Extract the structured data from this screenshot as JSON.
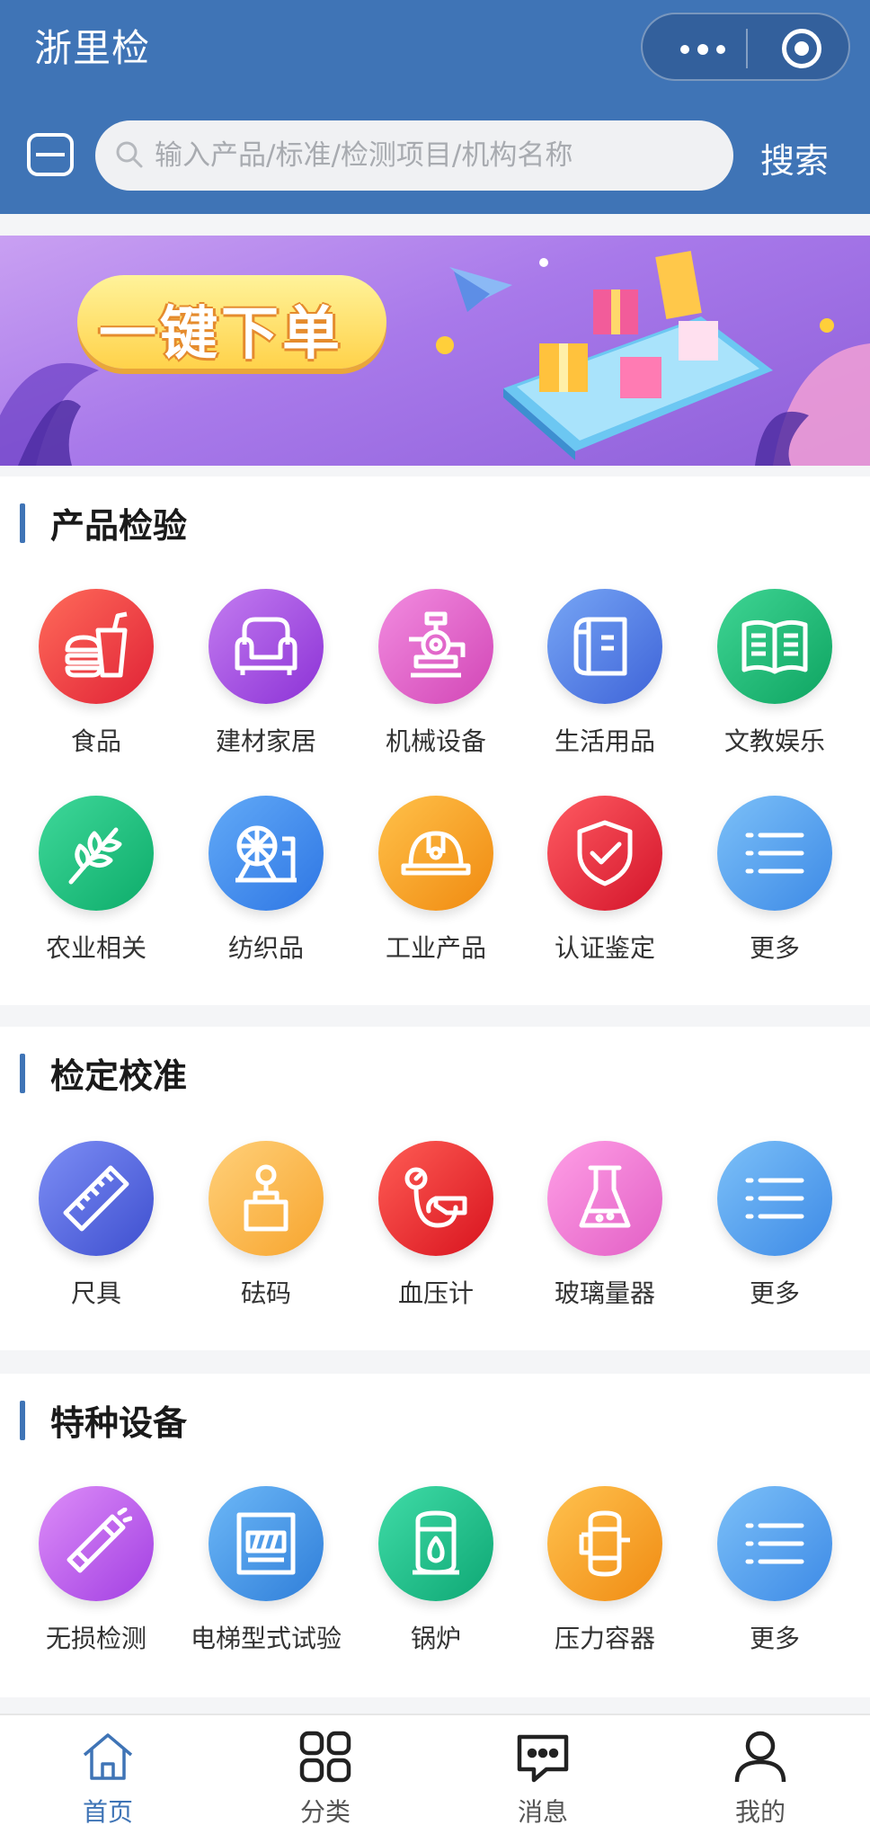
{
  "header": {
    "title": "浙里检",
    "menu_icon": "menu-card-icon",
    "search_placeholder": "输入产品/标准/检测项目/机构名称",
    "search_button": "搜索",
    "color": "#3f74b6"
  },
  "banner": {
    "text": "一键下单"
  },
  "sections": [
    {
      "title": "产品检验",
      "items": [
        {
          "label": "食品",
          "icon": "food-icon",
          "color": "#ee3b3b"
        },
        {
          "label": "建材家居",
          "icon": "sofa-icon",
          "color": "#a44fe0"
        },
        {
          "label": "机械设备",
          "icon": "machine-icon",
          "color": "#e065c9"
        },
        {
          "label": "生活用品",
          "icon": "tissue-icon",
          "color": "#4f7ee6"
        },
        {
          "label": "文教娱乐",
          "icon": "book-icon",
          "color": "#1fbf7a"
        },
        {
          "label": "农业相关",
          "icon": "leaf-icon",
          "color": "#1cc07f"
        },
        {
          "label": "纺织品",
          "icon": "loom-icon",
          "color": "#3d8ef0"
        },
        {
          "label": "工业产品",
          "icon": "hardhat-icon",
          "color": "#f9a21f"
        },
        {
          "label": "认证鉴定",
          "icon": "shield-check-icon",
          "color": "#ec3040"
        },
        {
          "label": "更多",
          "icon": "list-icon",
          "color": "#5aa4f0"
        }
      ]
    },
    {
      "title": "检定校准",
      "items": [
        {
          "label": "尺具",
          "icon": "ruler-icon",
          "color": "#5b6ee8"
        },
        {
          "label": "砝码",
          "icon": "weight-icon",
          "color": "#fbb64c"
        },
        {
          "label": "血压计",
          "icon": "blood-pressure-icon",
          "color": "#ee2f2f"
        },
        {
          "label": "玻璃量器",
          "icon": "flask-icon",
          "color": "#ef7ed6"
        },
        {
          "label": "更多",
          "icon": "list-icon",
          "color": "#5aa4f0"
        }
      ]
    },
    {
      "title": "特种设备",
      "items": [
        {
          "label": "无损检测",
          "icon": "probe-icon",
          "color": "#bf5ff0"
        },
        {
          "label": "电梯型式试验",
          "icon": "elevator-icon",
          "color": "#4a9eea"
        },
        {
          "label": "锅炉",
          "icon": "boiler-icon",
          "color": "#1dc389"
        },
        {
          "label": "压力容器",
          "icon": "pressure-vessel-icon",
          "color": "#f9a523"
        },
        {
          "label": "更多",
          "icon": "list-icon",
          "color": "#5aa4f0"
        }
      ]
    }
  ],
  "bottom_nav": [
    {
      "label": "首页",
      "icon": "home-icon",
      "active": true
    },
    {
      "label": "分类",
      "icon": "grid-icon",
      "active": false
    },
    {
      "label": "消息",
      "icon": "message-icon",
      "active": false
    },
    {
      "label": "我的",
      "icon": "user-icon",
      "active": false
    }
  ]
}
